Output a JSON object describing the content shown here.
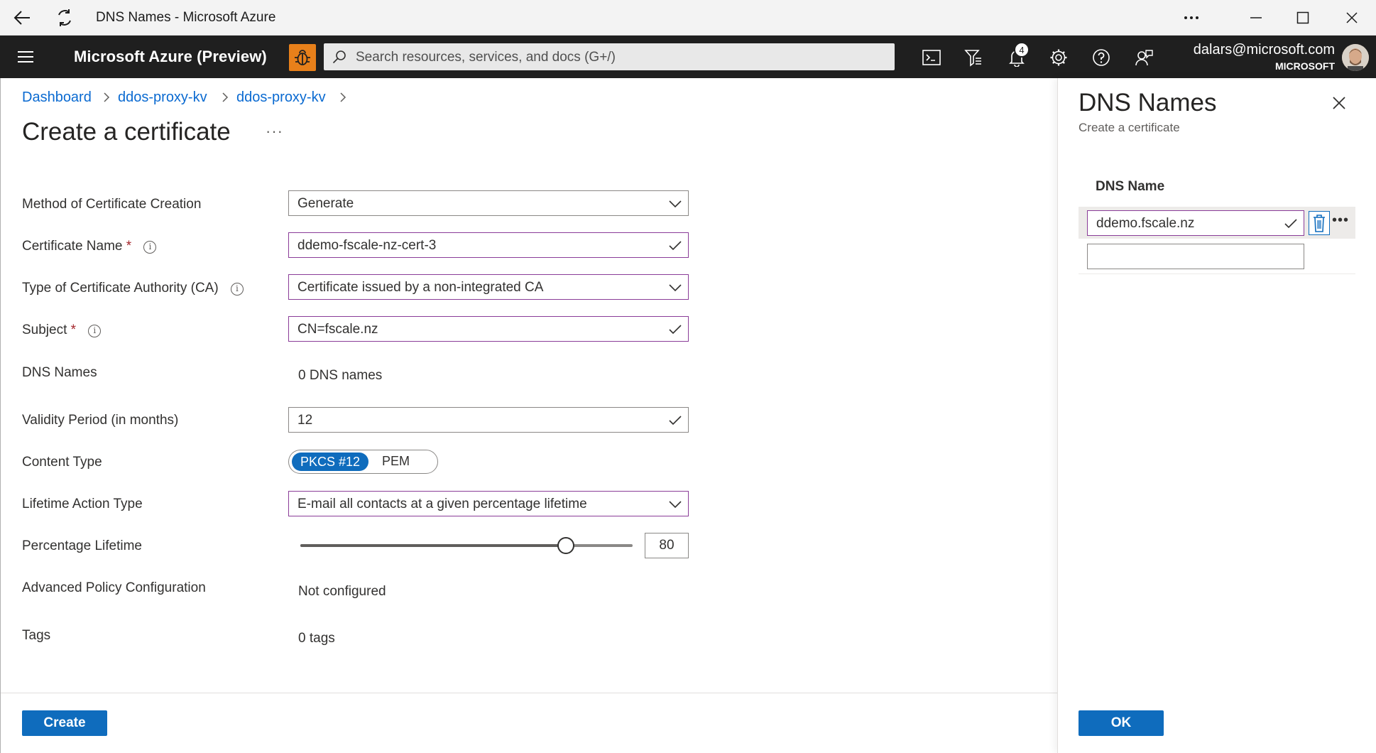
{
  "window": {
    "title": "DNS Names - Microsoft Azure"
  },
  "topbar": {
    "brand": "Microsoft Azure (Preview)",
    "search_placeholder": "Search resources, services, and docs (G+/)",
    "notification_count": "4",
    "user_email": "dalars@microsoft.com",
    "user_org": "MICROSOFT",
    "icons": [
      "cloud-shell-icon",
      "directory-filter-icon",
      "bell-icon",
      "gear-icon",
      "help-icon",
      "feedback-icon"
    ]
  },
  "breadcrumb": {
    "items": [
      "Dashboard",
      "ddos-proxy-kv",
      "ddos-proxy-kv"
    ],
    "separator": ">"
  },
  "page": {
    "title": "Create a certificate",
    "more": "···"
  },
  "form": {
    "method_label": "Method of Certificate Creation",
    "method_value": "Generate",
    "name_label": "Certificate Name",
    "name_value": "ddemo-fscale-nz-cert-3",
    "ca_label": "Type of Certificate Authority (CA)",
    "ca_value": "Certificate issued by a non-integrated CA",
    "subject_label": "Subject",
    "subject_value": "CN=fscale.nz",
    "dns_label": "DNS Names",
    "dns_value": "0 DNS names",
    "validity_label": "Validity Period (in months)",
    "validity_value": "12",
    "content_type_label": "Content Type",
    "content_type_options": [
      "PKCS #12",
      "PEM"
    ],
    "content_type_selected": "PKCS #12",
    "lifetime_label": "Lifetime Action Type",
    "lifetime_value": "E-mail all contacts at a given percentage lifetime",
    "percentage_label": "Percentage Lifetime",
    "percentage_value": "80",
    "percentage_fraction": 0.8,
    "advanced_label": "Advanced Policy Configuration",
    "advanced_value": "Not configured",
    "tags_label": "Tags",
    "tags_value": "0 tags",
    "required_mark": "*",
    "info_glyph": "i",
    "create_button": "Create"
  },
  "panel": {
    "title": "DNS Names",
    "subtitle": "Create a certificate",
    "column_header": "DNS Name",
    "rows": [
      "ddemo.fscale.nz",
      ""
    ],
    "row_more": "•••",
    "ok_button": "OK"
  },
  "colors": {
    "accent": "#0f6cbd",
    "link": "#0a6ad1",
    "valid_border": "#8a3c98",
    "topbar_bg": "#1f1f1f",
    "bug_orange": "#e8801a"
  }
}
